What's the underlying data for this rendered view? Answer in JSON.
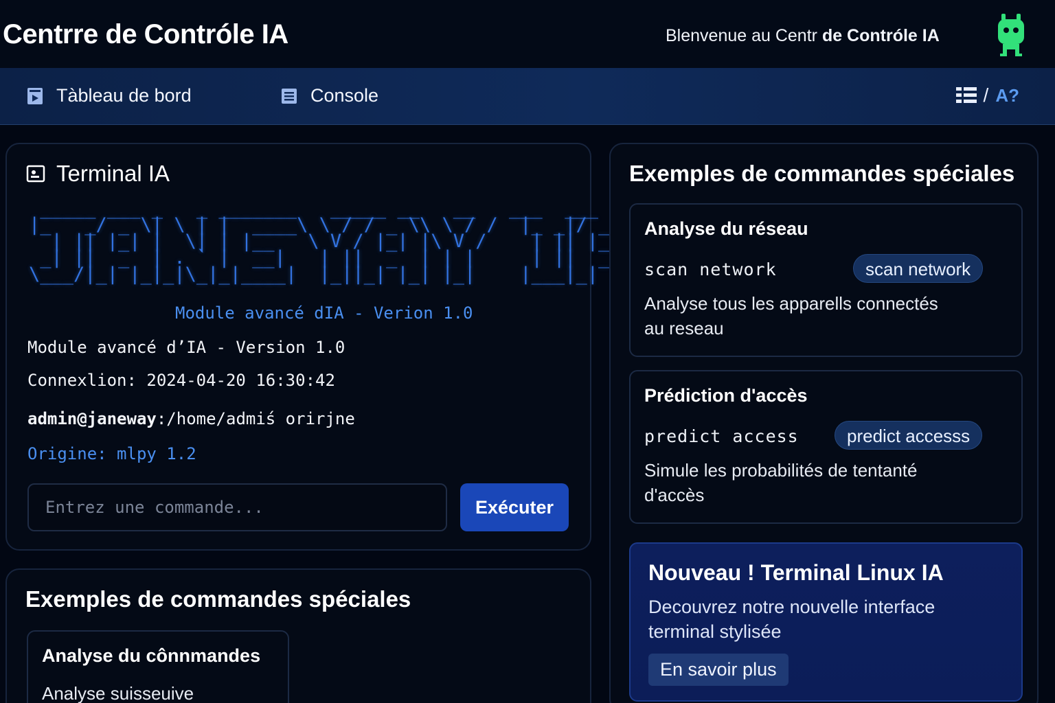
{
  "header": {
    "title": "Centrre de Contróle IA",
    "welcome_prefix": "Blenvenue au Centr ",
    "welcome_bold": "de Contróle IA",
    "mascot_icon": "robot-icon",
    "mascot_color": "#32e07a"
  },
  "nav": {
    "items": [
      {
        "label": "Tàbleau de bord",
        "icon": "dashboard-icon"
      },
      {
        "label": "Console",
        "icon": "console-icon"
      }
    ],
    "right_separator": "/",
    "language_label": "A?",
    "layout_icon": "list-layout-icon"
  },
  "terminal": {
    "title": "Terminal IA",
    "title_icon": "terminal-icon",
    "ascii_banner": " _____ ___ _   _ _______   _____ __   __   ___  ___\n|_   _/ _ \\| \\ | |  ____\\ \\ / / _ \\\\ \\ / /  |_ _|/ _ \\\n  | || |_| |  \\| | |__   \\ V / |_| |\\ V /    | || |_| |\n _| ||  _  | . ` |  __|   | ||  _  | | |     | ||  _  |\n\\___/|_| |_|_|\\_|_|____|  |_||_| |_| |_|    |___|_| |_|",
    "module_blue": "Module avancé dIA - Verion 1.0",
    "module_line": "Module avancé d’IA - Version 1.0",
    "connexion_line": "Connexlion: 2024-04-20 16:30:42",
    "prompt_user": "admin@janeway",
    "prompt_path": ":/home/admiś orirjne",
    "origin_line": "Origine: mlpy 1.2",
    "input_placeholder": "Entrez une commande...",
    "execute_label": "Exécuter",
    "accent_color": "#1a47b8"
  },
  "right_panel": {
    "title": "Exemples de commandes spéciales",
    "cards": [
      {
        "title": "Analyse du réseau",
        "command": "scan network",
        "pill": "scan network",
        "description_line1": "Analyse tous les apparells connectés",
        "description_line2": "au reseau"
      },
      {
        "title": "Prédiction d'accès",
        "command": "predict access",
        "pill": "predict accesss",
        "description_line1": "Simule les probabilités de tentanté",
        "description_line2": "d'accès"
      }
    ],
    "promo": {
      "title": "Nouveau ! Terminal Linux IA",
      "description_line1": "Decouvrez notre nouvelle interface",
      "description_line2": "terminal stylisée",
      "button_label": "En savoir plus"
    }
  },
  "left_bottom_panel": {
    "title": "Exemples de commandes spéciales",
    "card": {
      "title": "Analyse du cônnmandes",
      "description": "Analyse suisseuive"
    }
  }
}
